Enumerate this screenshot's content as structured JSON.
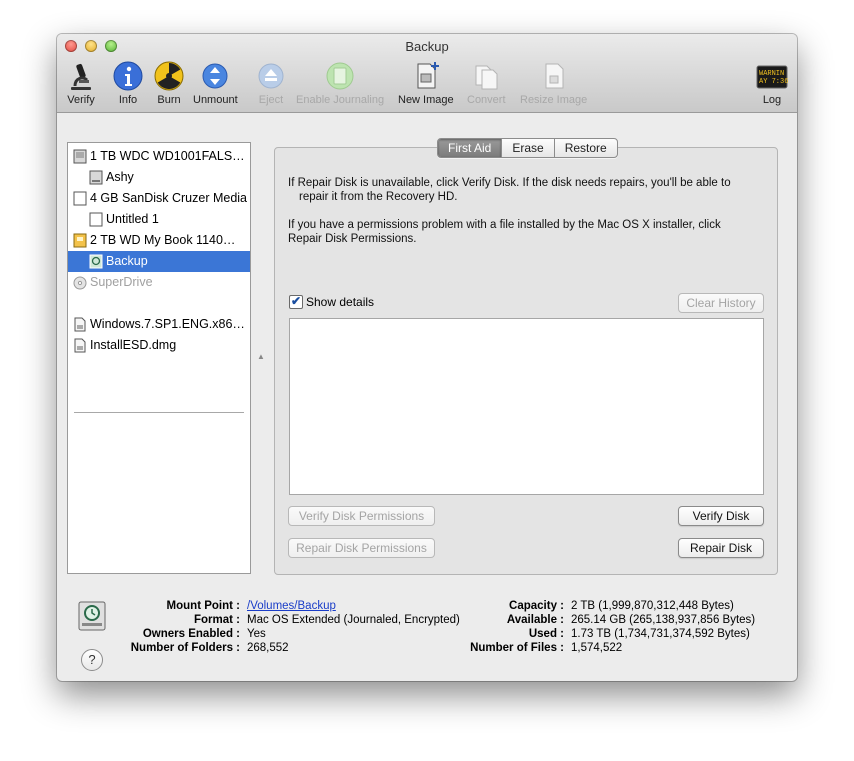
{
  "window": {
    "title": "Backup"
  },
  "toolbar": {
    "verify": "Verify",
    "info": "Info",
    "burn": "Burn",
    "unmount": "Unmount",
    "eject": "Eject",
    "enable_journaling": "Enable Journaling",
    "new_image": "New Image",
    "convert": "Convert",
    "resize_image": "Resize Image",
    "log": "Log",
    "log_icon_text": [
      "WARNIN",
      "AY 7:36"
    ]
  },
  "sidebar": {
    "items": [
      {
        "label": "1 TB WDC WD1001FALS…",
        "icon": "hard-drive-icon"
      },
      {
        "label": "Ashy",
        "icon": "volume-icon"
      },
      {
        "label": "4 GB SanDisk Cruzer Media",
        "icon": "usb-drive-icon"
      },
      {
        "label": "Untitled 1",
        "icon": "volume-icon"
      },
      {
        "label": "2 TB WD My Book 1140…",
        "icon": "external-drive-icon"
      },
      {
        "label": "Backup",
        "icon": "time-machine-volume-icon",
        "selected": true
      },
      {
        "label": "SuperDrive",
        "icon": "optical-drive-icon"
      }
    ],
    "images": [
      {
        "label": "Windows.7.SP1.ENG.x86…",
        "icon": "disk-image-icon"
      },
      {
        "label": "InstallESD.dmg",
        "icon": "disk-image-icon"
      }
    ]
  },
  "tabs": {
    "first_aid": "First Aid",
    "erase": "Erase",
    "restore": "Restore"
  },
  "first_aid": {
    "para1_line1": "If Repair Disk is unavailable, click Verify Disk. If the disk needs repairs, you'll be able to",
    "para1_line2": "repair it from the Recovery HD.",
    "para2_line1": "If you have a permissions problem with a file installed by the Mac OS X installer, click",
    "para2_line2": "Repair Disk Permissions.",
    "show_details": "Show details",
    "show_details_checked": true,
    "clear_history": "Clear History",
    "verify_permissions": "Verify Disk Permissions",
    "repair_permissions": "Repair Disk Permissions",
    "verify_disk": "Verify Disk",
    "repair_disk": "Repair Disk"
  },
  "info": {
    "mount_point_label": "Mount Point :",
    "mount_point": "/Volumes/Backup",
    "format_label": "Format :",
    "format": "Mac OS Extended (Journaled, Encrypted)",
    "owners_label": "Owners Enabled :",
    "owners": "Yes",
    "folders_label": "Number of Folders :",
    "folders": "268,552",
    "capacity_label": "Capacity :",
    "capacity": "2 TB (1,999,870,312,448 Bytes)",
    "available_label": "Available :",
    "available": "265.14 GB (265,138,937,856 Bytes)",
    "used_label": "Used :",
    "used": "1.73 TB (1,734,731,374,592 Bytes)",
    "files_label": "Number of Files :",
    "files": "1,574,522",
    "help": "?"
  }
}
